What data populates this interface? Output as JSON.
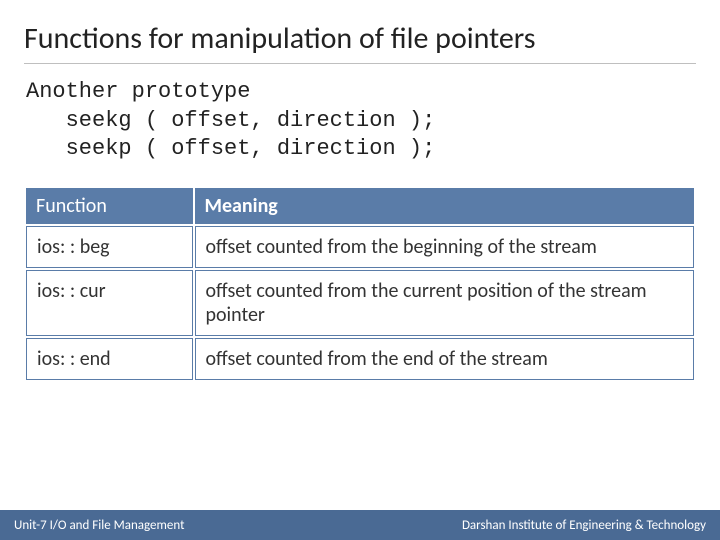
{
  "title": "Functions for manipulation of file pointers",
  "prototype": "Another prototype\n   seekg ( offset, direction );\n   seekp ( offset, direction );",
  "table": {
    "headers": {
      "func": "Function",
      "meaning": "Meaning"
    },
    "rows": [
      {
        "func": "ios: : beg",
        "meaning": "offset counted from the beginning of the stream"
      },
      {
        "func": "ios: : cur",
        "meaning": "offset counted from the current position of the stream pointer"
      },
      {
        "func": "ios: : end",
        "meaning": "offset counted from the end of the stream"
      }
    ]
  },
  "footer": {
    "left": "Unit-7 I/O and File Management",
    "right": "Darshan Institute of Engineering & Technology"
  }
}
